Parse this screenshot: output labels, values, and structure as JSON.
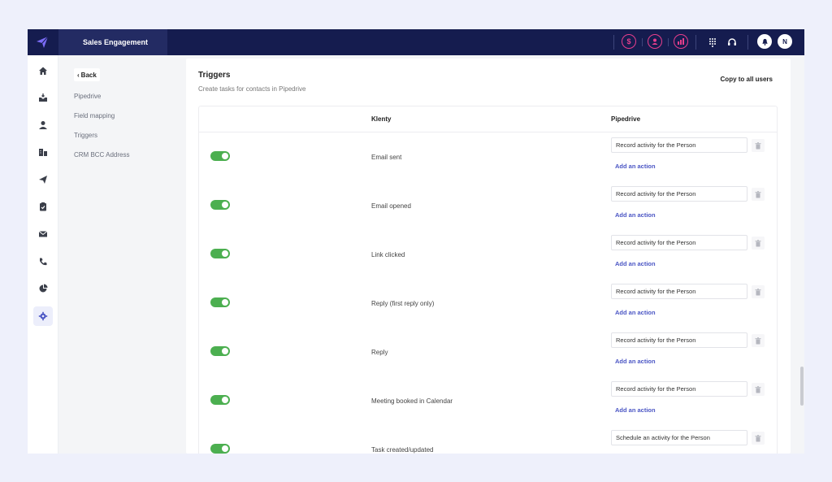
{
  "topbar": {
    "app_tab": "Sales Engagement",
    "icons": [
      "dollar-icon",
      "user-icon",
      "chart-icon",
      "dialpad-icon",
      "headset-icon",
      "bell-icon"
    ],
    "avatar_initial": "N",
    "accent": "#e83e8c",
    "background": "#151c4f"
  },
  "rail": {
    "items": [
      "home-icon",
      "inbox-icon",
      "person-icon",
      "buildings-icon",
      "send-icon",
      "clipboard-icon",
      "mail-icon",
      "phone-icon",
      "pie-chart-icon",
      "gear-icon"
    ],
    "active": "gear-icon"
  },
  "submenu": {
    "back_label": "Back",
    "items": [
      "Pipedrive",
      "Field mapping",
      "Triggers",
      "CRM BCC Address"
    ]
  },
  "panel": {
    "title": "Triggers",
    "subtitle": "Create tasks for contacts in Pipedrive",
    "copy_button": "Copy to all users",
    "columns": {
      "klenty": "Klenty",
      "pipedrive": "Pipedrive"
    },
    "add_action_label": "Add an action",
    "rows": [
      {
        "enabled": true,
        "trigger": "Email sent",
        "action": "Record activity for the Person"
      },
      {
        "enabled": true,
        "trigger": "Email opened",
        "action": "Record activity for the Person"
      },
      {
        "enabled": true,
        "trigger": "Link clicked",
        "action": "Record activity for the Person"
      },
      {
        "enabled": true,
        "trigger": "Reply (first reply only)",
        "action": "Record activity for the Person"
      },
      {
        "enabled": true,
        "trigger": "Reply",
        "action": "Record activity for the Person"
      },
      {
        "enabled": true,
        "trigger": "Meeting booked in Calendar",
        "action": "Record activity for the Person"
      },
      {
        "enabled": true,
        "trigger": "Task created/updated",
        "action": "Schedule an activity for the Person"
      }
    ]
  },
  "colors": {
    "toggle_on": "#4caf50",
    "link": "#4a55c4"
  }
}
